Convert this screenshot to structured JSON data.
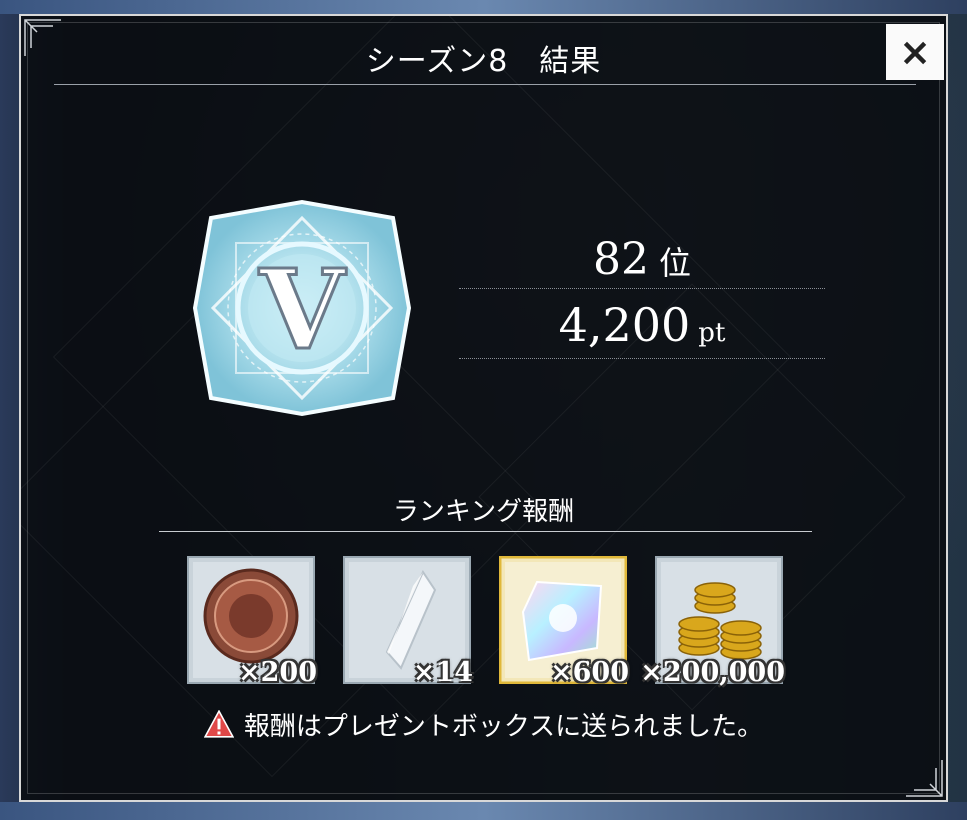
{
  "dialog": {
    "title": "シーズン8　結果",
    "close_label": "×"
  },
  "emblem": {
    "letter": "V",
    "icon": "rank-emblem-icon",
    "color": "#9fd8e8"
  },
  "result": {
    "rank_value": "82",
    "rank_unit": "位",
    "points_value": "4,200",
    "points_unit": "pt"
  },
  "rewards": {
    "title": "ランキング報酬",
    "items": [
      {
        "icon": "bronze-medal-icon",
        "count": "×200",
        "frame_color": "#b8c4cc"
      },
      {
        "icon": "crystal-icon",
        "count": "×14",
        "frame_color": "#b8c4cc"
      },
      {
        "icon": "rainbow-gem-icon",
        "count": "×600",
        "frame_color": "#e8c84a"
      },
      {
        "icon": "gold-coins-icon",
        "count": "×200,000",
        "frame_color": "#b8c4cc"
      }
    ]
  },
  "notice": {
    "icon": "warning-icon",
    "text": "報酬はプレゼントボックスに送られました。"
  }
}
